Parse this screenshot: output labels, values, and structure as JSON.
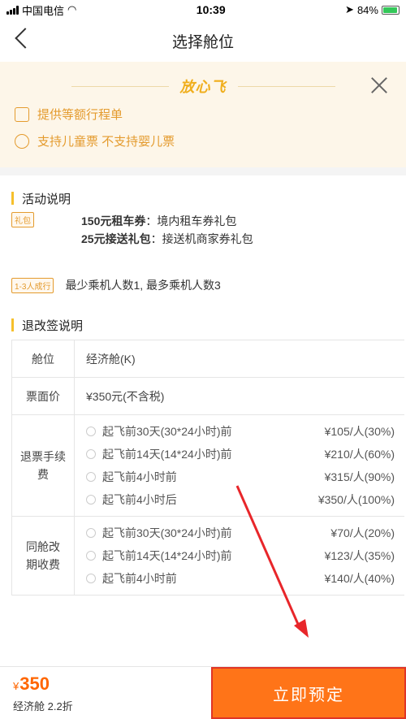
{
  "status_bar": {
    "carrier": "中国电信",
    "time": "10:39",
    "battery": "84%"
  },
  "nav": {
    "title": "选择舱位"
  },
  "banner": {
    "logo_text": "放心飞",
    "features": [
      {
        "icon": "edit-icon",
        "text": "提供等额行程单"
      },
      {
        "icon": "smile-icon",
        "text": "支持儿童票 不支持婴儿票"
      }
    ]
  },
  "activity": {
    "title": "活动说明",
    "gift_tag": "礼包",
    "gifts": [
      {
        "bold": "150元租车券",
        "text": "：境内租车券礼包"
      },
      {
        "bold": "25元接送礼包",
        "text": "：接送机商家券礼包"
      }
    ],
    "group_tag": "1-3人成行",
    "group_rule": "最少乘机人数1, 最多乘机人数3"
  },
  "refund": {
    "title": "退改签说明",
    "rows": [
      {
        "label": "舱位",
        "value": "经济舱(K)"
      },
      {
        "label": "票面价",
        "value": "¥350元(不含税)"
      }
    ],
    "refund_fee": {
      "label": "退票手续费",
      "items": [
        {
          "cond": "起飞前30天(30*24小时)前",
          "price": "¥105/人(30%)"
        },
        {
          "cond": "起飞前14天(14*24小时)前",
          "price": "¥210/人(60%)"
        },
        {
          "cond": "起飞前4小时前",
          "price": "¥315/人(90%)"
        },
        {
          "cond": "起飞前4小时后",
          "price": "¥350/人(100%)"
        }
      ]
    },
    "change_fee": {
      "label": "同舱改期收费",
      "items": [
        {
          "cond": "起飞前30天(30*24小时)前",
          "price": "¥70/人(20%)"
        },
        {
          "cond": "起飞前14天(14*24小时)前",
          "price": "¥123/人(35%)"
        },
        {
          "cond": "起飞前4小时前",
          "price": "¥140/人(40%)"
        }
      ]
    }
  },
  "bottom": {
    "currency": "¥",
    "price": "350",
    "cabin_discount": "经济舱 2.2折",
    "book_label": "立即预定"
  },
  "colors": {
    "accent": "#ff7418",
    "price": "#ff6600",
    "gold": "#e49b2e",
    "annotation": "#e8262a"
  }
}
